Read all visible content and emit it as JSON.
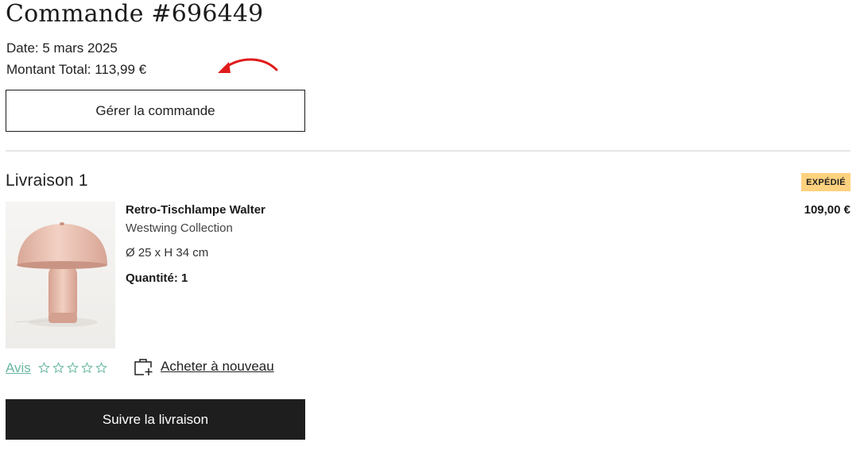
{
  "order": {
    "title": "Commande #696449",
    "date": "Date: 5 mars 2025",
    "total": "Montant Total: 113,99 €",
    "manage_label": "Gérer la commande"
  },
  "shipment": {
    "title": "Livraison 1",
    "status": "EXPÉDIÉ",
    "status_color": "#ffd27f",
    "item": {
      "name": "Retro-Tischlampe Walter",
      "brand": "Westwing Collection",
      "dimensions": "Ø 25 x H 34 cm",
      "quantity": "Quantité: 1",
      "price": "109,00 €",
      "image_icon": "mushroom-table-lamp-image"
    },
    "review_label": "Avis",
    "review_rating": 0,
    "review_max": 5,
    "rebuy_label": "Acheter à nouveau",
    "rebuy_icon": "bag-plus-icon",
    "track_label": "Suivre la livraison"
  },
  "colors": {
    "accent_green": "#6ab6a3",
    "annotation_red": "#e01b1b",
    "dark_button": "#1e1e1e"
  }
}
